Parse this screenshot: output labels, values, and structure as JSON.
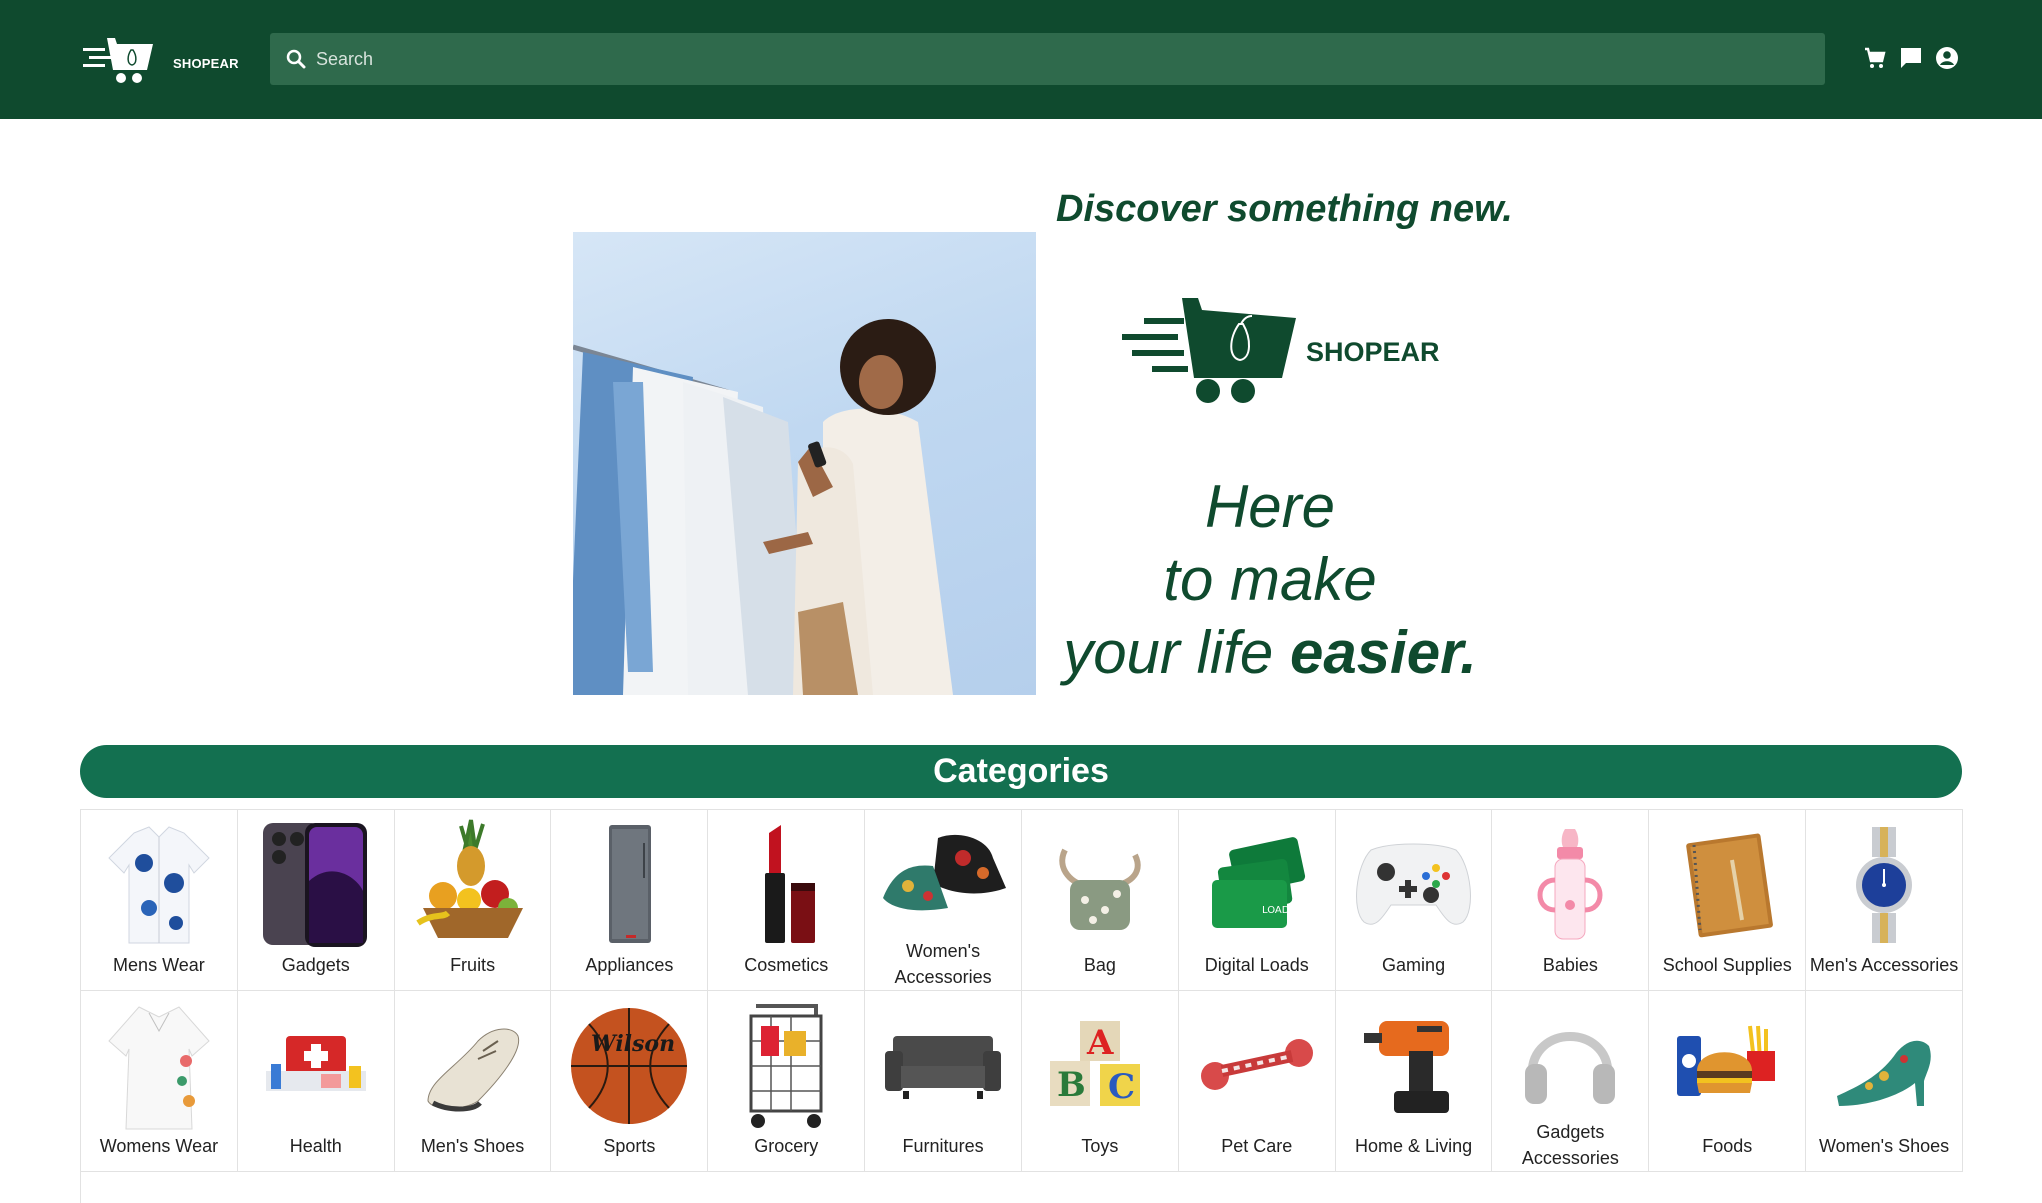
{
  "brand": {
    "name": "SHOPEAR",
    "primary": "#0f4a2e",
    "accent": "#137050",
    "search_bg": "#2f6a4c"
  },
  "header": {
    "search_placeholder": "Search",
    "icons": [
      "cart-icon",
      "chat-icon",
      "account-icon"
    ]
  },
  "hero": {
    "headline": "Discover something new.",
    "logo_text": "SHOPEAR",
    "tagline_1": "Here",
    "tagline_2": "to make",
    "tagline_3": "your life",
    "tagline_bold": "easier."
  },
  "categories": {
    "title": "Categories",
    "items": [
      {
        "label": "Mens Wear",
        "icon": "shirt"
      },
      {
        "label": "Gadgets",
        "icon": "phone"
      },
      {
        "label": "Fruits",
        "icon": "fruit-basket"
      },
      {
        "label": "Appliances",
        "icon": "refrigerator"
      },
      {
        "label": "Cosmetics",
        "icon": "lipstick"
      },
      {
        "label": "Women's Accessories",
        "icon": "bucket-hat"
      },
      {
        "label": "Bag",
        "icon": "bag"
      },
      {
        "label": "Digital Loads",
        "icon": "prepaid-cards"
      },
      {
        "label": "Gaming",
        "icon": "game-controller"
      },
      {
        "label": "Babies",
        "icon": "baby-bottle"
      },
      {
        "label": "School Supplies",
        "icon": "notebook"
      },
      {
        "label": "Men's Accessories",
        "icon": "watch"
      },
      {
        "label": "Womens Wear",
        "icon": "blouse"
      },
      {
        "label": "Health",
        "icon": "first-aid-kit"
      },
      {
        "label": "Men's Shoes",
        "icon": "shoe"
      },
      {
        "label": "Sports",
        "icon": "basketball"
      },
      {
        "label": "Grocery",
        "icon": "shopping-cart"
      },
      {
        "label": "Furnitures",
        "icon": "sofa"
      },
      {
        "label": "Toys",
        "icon": "abc-blocks"
      },
      {
        "label": "Pet Care",
        "icon": "dog-toy"
      },
      {
        "label": "Home & Living",
        "icon": "drill"
      },
      {
        "label": "Gadgets Accessories",
        "icon": "headphones"
      },
      {
        "label": "Foods",
        "icon": "burger-meal"
      },
      {
        "label": "Women's Shoes",
        "icon": "heel-shoe"
      }
    ]
  }
}
